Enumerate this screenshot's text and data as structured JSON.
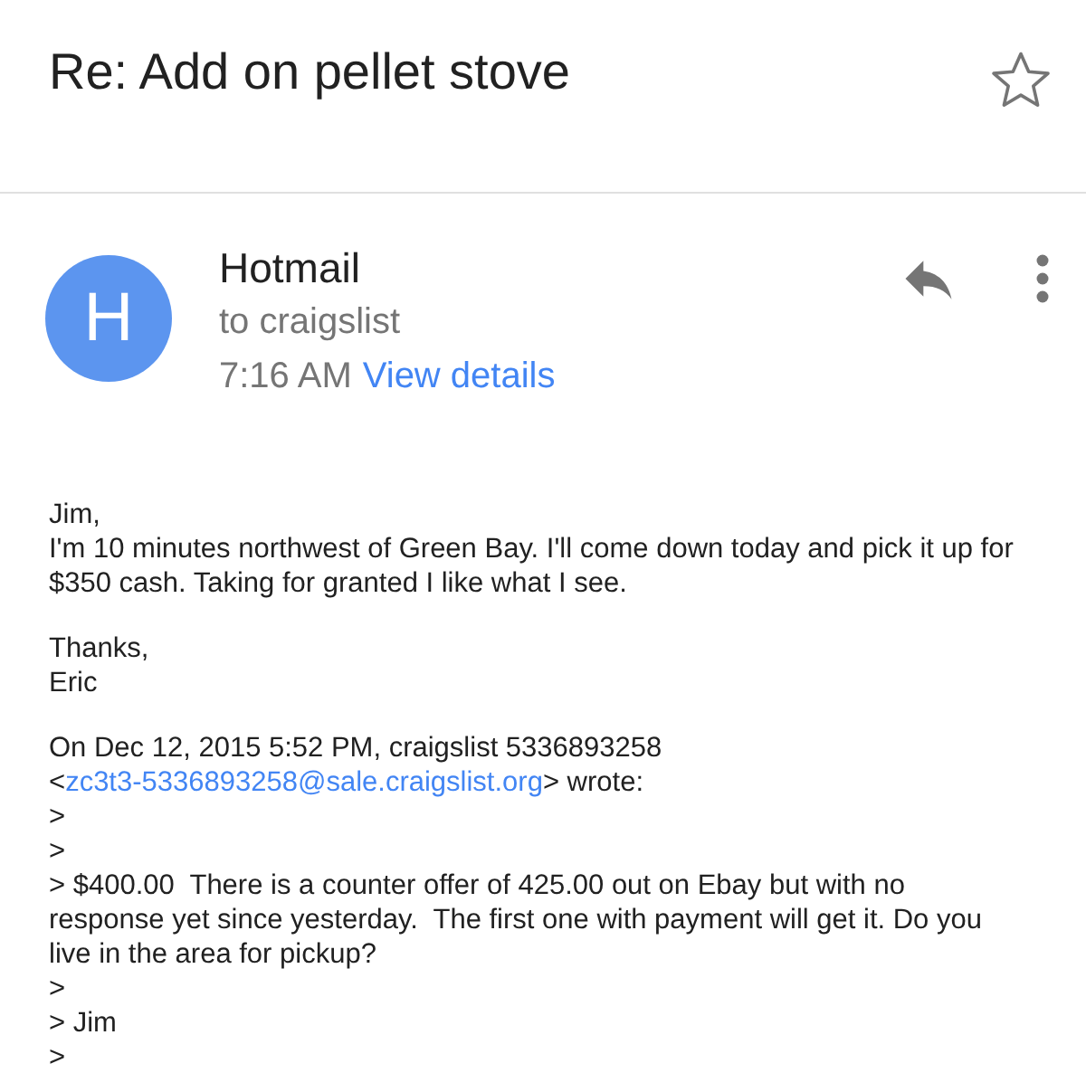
{
  "subject": "Re: Add on pellet stove",
  "starred": false,
  "sender": {
    "initial": "H",
    "name": "Hotmail",
    "to": "to craigslist",
    "time": "7:16 AM",
    "details_link": "View details"
  },
  "body": [
    {
      "kind": "text",
      "lines": [
        "Jim,",
        "I'm 10 minutes northwest of Green Bay. I'll come down today and pick it up for $350 cash. Taking for granted I like what I see."
      ]
    },
    {
      "kind": "text",
      "lines": [
        "Thanks,",
        "Eric"
      ]
    },
    {
      "kind": "attribution",
      "before": "On Dec 12, 2015 5:52 PM, craigslist 5336893258 <",
      "link": "zc3t3-5336893258@sale.craigslist.org",
      "after": "> wrote:"
    },
    {
      "kind": "quote",
      "lines": [
        ">",
        ">",
        "> $400.00  There is a counter offer of 425.00 out on Ebay but with no response yet since yesterday.  The first one with payment will get it. Do you live in the area for pickup?",
        ">",
        "> Jim",
        ">"
      ]
    }
  ]
}
